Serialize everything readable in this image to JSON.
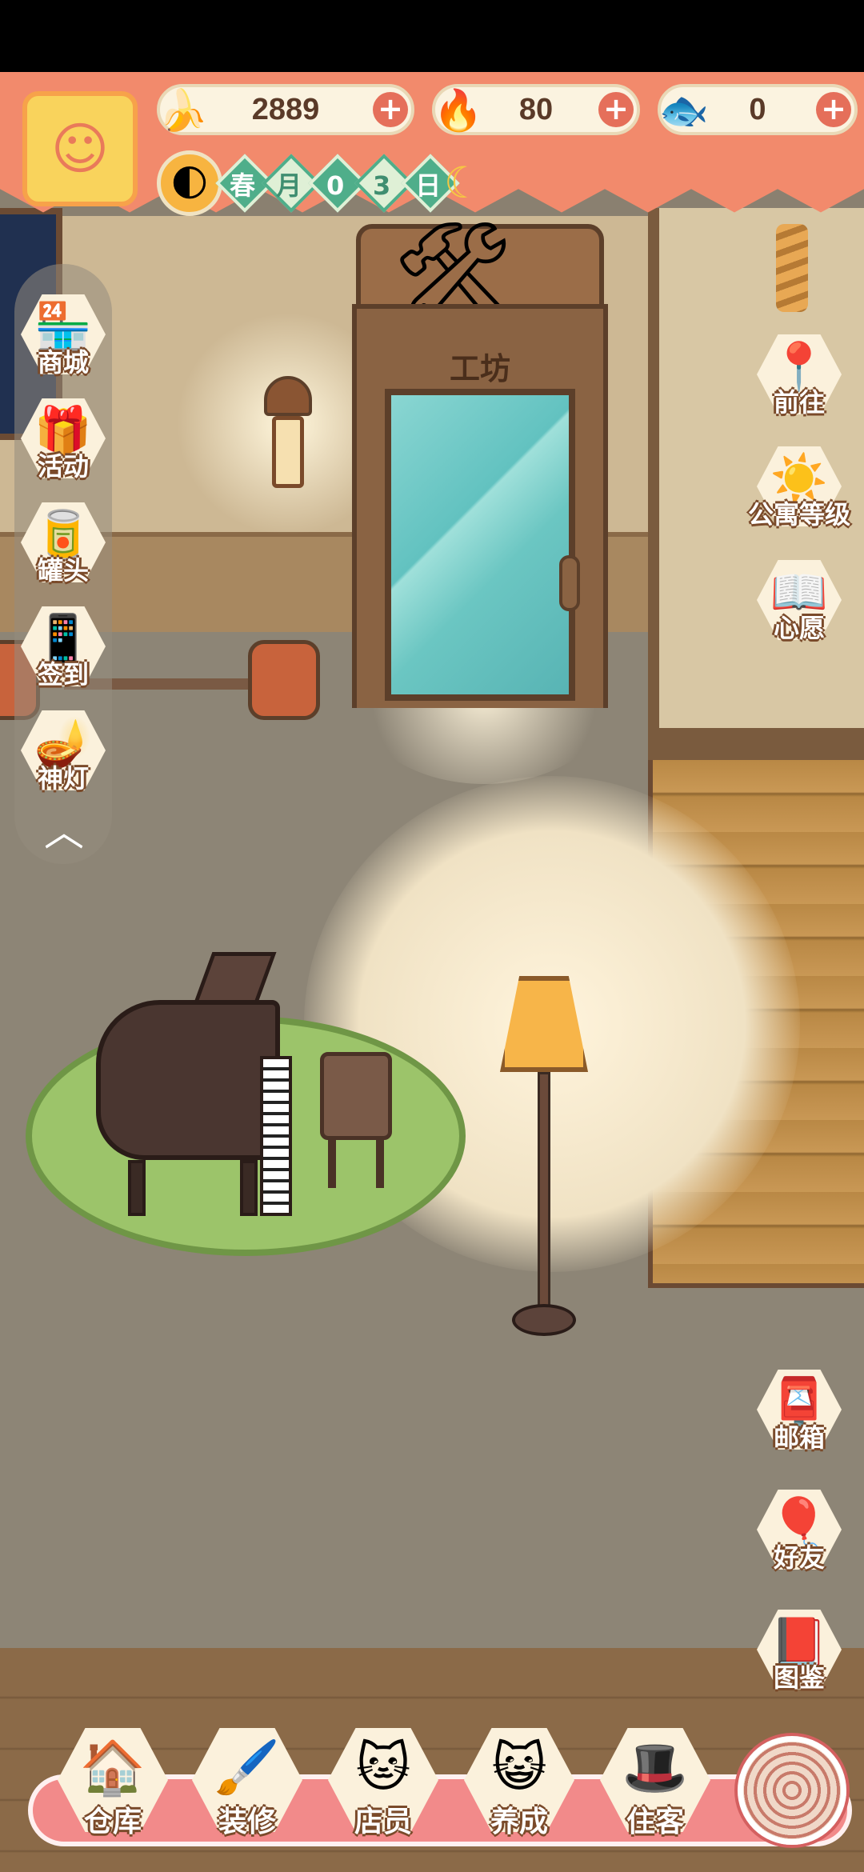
{
  "currencies": [
    {
      "name": "banana",
      "icon": "🍌",
      "value": "2889"
    },
    {
      "name": "flame",
      "icon": "🔥",
      "value": "80"
    },
    {
      "name": "blue-banana",
      "icon": "🐟",
      "value": "0"
    }
  ],
  "plus_symbol": "+",
  "date": {
    "season": "春",
    "unit_month": "月",
    "digits": [
      "0",
      "3"
    ],
    "unit_day": "日"
  },
  "door_sign": "工坊",
  "left_menu": [
    {
      "id": "shop",
      "label": "商城",
      "icon": "🏪"
    },
    {
      "id": "events",
      "label": "活动",
      "icon": "🎁"
    },
    {
      "id": "cans",
      "label": "罐头",
      "icon": "🥫"
    },
    {
      "id": "checkin",
      "label": "签到",
      "icon": "📱"
    },
    {
      "id": "lamp",
      "label": "神灯",
      "icon": "🪔"
    }
  ],
  "collapse_symbol": "︿",
  "right_menu_top": [
    {
      "id": "goto",
      "label": "前往",
      "icon": "📍"
    },
    {
      "id": "apartment-level",
      "label": "公寓等级",
      "icon": "☀️"
    },
    {
      "id": "wish",
      "label": "心愿",
      "icon": "📖"
    }
  ],
  "right_menu_bottom": [
    {
      "id": "mailbox",
      "label": "邮箱",
      "icon": "📮"
    },
    {
      "id": "friends",
      "label": "好友",
      "icon": "🎈"
    },
    {
      "id": "collection",
      "label": "图鉴",
      "icon": "📕"
    }
  ],
  "bottom_nav": [
    {
      "id": "warehouse",
      "label": "仓库",
      "icon": "🏠"
    },
    {
      "id": "decorate",
      "label": "装修",
      "icon": "🖌️"
    },
    {
      "id": "staff",
      "label": "店员",
      "icon": "🐱"
    },
    {
      "id": "raise",
      "label": "养成",
      "icon": "😺"
    },
    {
      "id": "tenants",
      "label": "住客",
      "icon": "🎩"
    }
  ],
  "colors": {
    "hud": "#f28a6c",
    "bottom_bar": "#f28a8a",
    "label_outline": "#7a4a2a"
  }
}
